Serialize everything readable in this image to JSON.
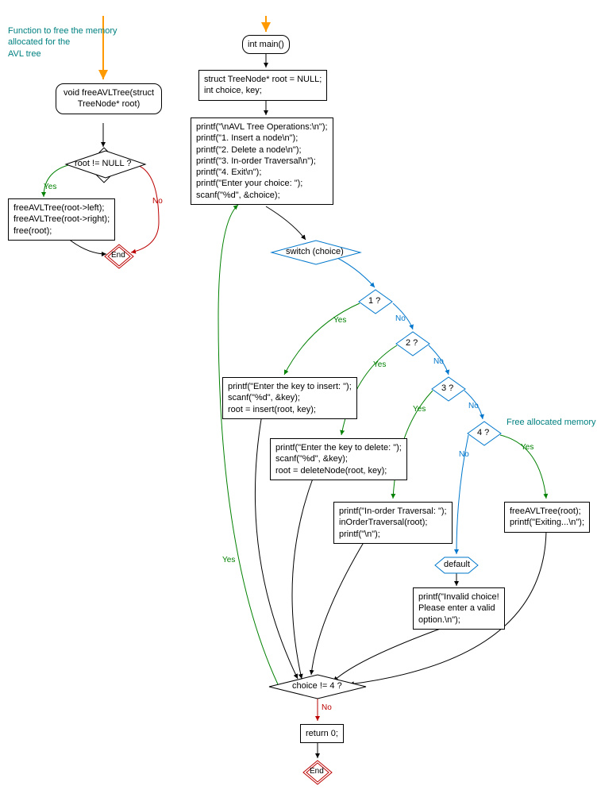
{
  "left": {
    "annotation": "Function to free the memory\nallocated for the\nAVL tree",
    "func_decl": "void freeAVLTree(struct\nTreeNode* root)",
    "cond": "root != NULL ?",
    "body": "freeAVLTree(root->left);\nfreeAVLTree(root->right);\nfree(root);",
    "end": "End",
    "yes": "Yes",
    "no": "No"
  },
  "right": {
    "main": "int main()",
    "decl": "struct TreeNode* root = NULL;\nint choice, key;",
    "menu": "printf(\"\\nAVL Tree Operations:\\n\");\nprintf(\"1. Insert a node\\n\");\nprintf(\"2. Delete a node\\n\");\nprintf(\"3. In-order Traversal\\n\");\nprintf(\"4. Exit\\n\");\nprintf(\"Enter your choice: \");\nscanf(\"%d\", &choice);",
    "switch": "switch (choice)",
    "c1": "1 ?",
    "c2": "2 ?",
    "c3": "3 ?",
    "c4": "4 ?",
    "case1": "printf(\"Enter the key to insert: \");\nscanf(\"%d\", &key);\nroot = insert(root, key);",
    "case2": "printf(\"Enter the key to delete: \");\nscanf(\"%d\", &key);\nroot = deleteNode(root, key);",
    "case3": "printf(\"In-order Traversal: \");\ninOrderTraversal(root);\nprintf(\"\\n\");",
    "case4": "freeAVLTree(root);\nprintf(\"Exiting...\\n\");",
    "default_label": "default",
    "default_body": "printf(\"Invalid choice!\nPlease enter a valid\noption.\\n\");",
    "loop_cond": "choice != 4 ?",
    "return": "return 0;",
    "end": "End",
    "yes": "Yes",
    "no": "No",
    "free_annotation": "Free allocated memory"
  }
}
